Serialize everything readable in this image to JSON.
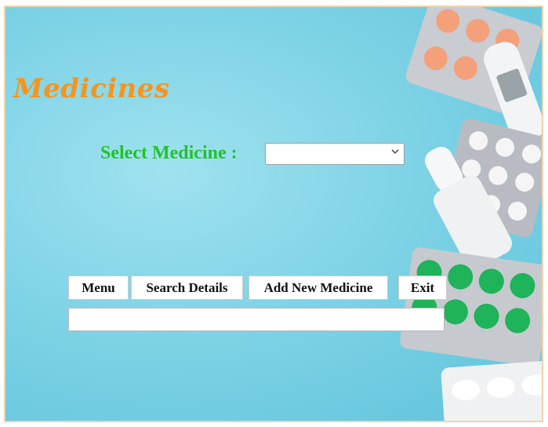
{
  "page": {
    "title": "Medicines"
  },
  "form": {
    "select_label": "Select Medicine :",
    "select_value": ""
  },
  "buttons": {
    "menu": "Menu",
    "search": "Search Details",
    "add": "Add New Medicine",
    "exit": "Exit"
  },
  "status": {
    "value": ""
  },
  "colors": {
    "title": "#f7941d",
    "label": "#22c32b",
    "background": "#7fd3e6"
  },
  "icons": {
    "select_arrow": "chevron-down-icon"
  }
}
